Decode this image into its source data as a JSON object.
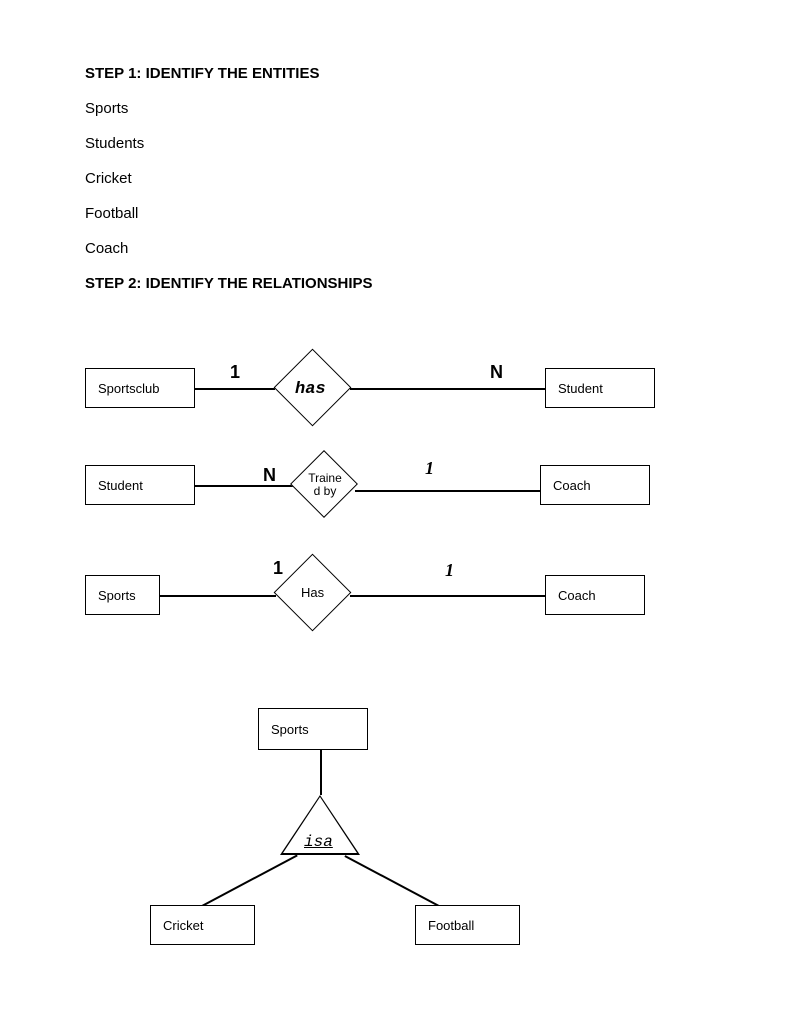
{
  "steps": {
    "step1_title": "STEP 1: IDENTIFY THE ENTITIES",
    "entities": [
      "Sports",
      "Students",
      "Cricket",
      "Football",
      "Coach"
    ],
    "step2_title": "STEP 2: IDENTIFY THE RELATIONSHIPS"
  },
  "rel1": {
    "left_entity": "Sportsclub",
    "left_card": "1",
    "relation": "has",
    "right_card": "N",
    "right_entity": "Student"
  },
  "rel2": {
    "left_entity": "Student",
    "left_card": "N",
    "relation": "Traine d by",
    "right_card": "1",
    "right_entity": "Coach"
  },
  "rel3": {
    "left_entity": "Sports",
    "left_card": "1",
    "relation": "Has",
    "right_card": "1",
    "right_entity": "Coach"
  },
  "isa": {
    "parent": "Sports",
    "relation": "isa",
    "child_left": "Cricket",
    "child_right": "Football"
  }
}
